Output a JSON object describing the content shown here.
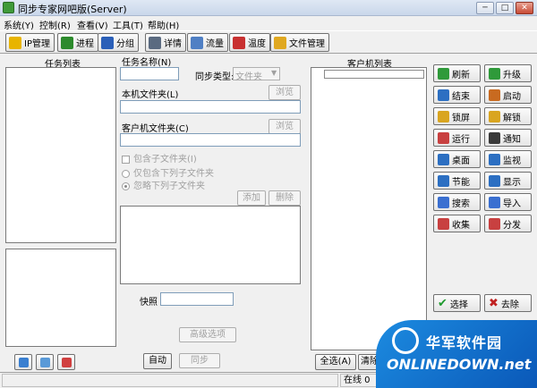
{
  "window": {
    "title": "同步专家网吧版(Server)",
    "minimize": "─",
    "maximize": "□",
    "close": "✕"
  },
  "menu": [
    "系统(Y)",
    "控制(R)",
    "查看(V)",
    "工具(T)",
    "帮助(H)"
  ],
  "toolbar": [
    {
      "label": "IP管理",
      "icon": "network-icon",
      "color": "#e8b400"
    },
    {
      "label": "进程",
      "icon": "process-icon",
      "color": "#2c8a2c"
    },
    {
      "label": "分组",
      "icon": "group-icon",
      "color": "#2a5fb8"
    },
    {
      "label": "详情",
      "icon": "details-icon",
      "color": "#5a6a80"
    },
    {
      "label": "流量",
      "icon": "traffic-icon",
      "color": "#4f7fc4"
    },
    {
      "label": "温度",
      "icon": "thermometer-icon",
      "color": "#c83030"
    },
    {
      "label": "文件管理",
      "icon": "file-manager-icon",
      "color": "#e0a820"
    }
  ],
  "task_panel": {
    "title": "任务列表"
  },
  "task_form": {
    "task_name_label": "任务名称(N)",
    "sync_type_label": "同步类型:",
    "sync_type_value": "文件夹",
    "local_folder_label": "本机文件夹(L)",
    "browse_label": "浏览",
    "client_folder_label": "客户机文件夹(C)",
    "include_subfolders_label": "包含子文件夹(I)",
    "only_include_label": "仅包含下列子文件夹",
    "ignore_label": "忽略下列子文件夹",
    "add_label": "添加",
    "delete_label": "删除",
    "snapshot_label": "快照",
    "advanced_label": "高级选项",
    "auto_label": "自动",
    "sync_label": "同步"
  },
  "client_panel": {
    "title": "客户机列表",
    "select_all": "全选(A)",
    "clear": "清除"
  },
  "actions": [
    {
      "label": "刷新",
      "icon": "refresh-icon",
      "color": "#2f9a3a"
    },
    {
      "label": "升级",
      "icon": "upgrade-icon",
      "color": "#2f9a3a"
    },
    {
      "label": "结束",
      "icon": "end-icon",
      "color": "#2c6fc2"
    },
    {
      "label": "启动",
      "icon": "start-icon",
      "color": "#c86a20"
    },
    {
      "label": "锁屏",
      "icon": "lock-screen-icon",
      "color": "#d9a520"
    },
    {
      "label": "解锁",
      "icon": "unlock-icon",
      "color": "#d9a520"
    },
    {
      "label": "运行",
      "icon": "run-icon",
      "color": "#c84040"
    },
    {
      "label": "通知",
      "icon": "notify-icon",
      "color": "#3a3a3a"
    },
    {
      "label": "桌面",
      "icon": "desktop-icon",
      "color": "#2c6fc2"
    },
    {
      "label": "监视",
      "icon": "monitor-icon",
      "color": "#2c6fc2"
    },
    {
      "label": "节能",
      "icon": "power-save-icon",
      "color": "#2c6fc2"
    },
    {
      "label": "显示",
      "icon": "display-icon",
      "color": "#2c6fc2"
    },
    {
      "label": "搜索",
      "icon": "search-icon",
      "color": "#3a6fd0"
    },
    {
      "label": "导入",
      "icon": "import-icon",
      "color": "#3a6fd0"
    },
    {
      "label": "收集",
      "icon": "collect-icon",
      "color": "#c84040"
    },
    {
      "label": "分发",
      "icon": "distribute-icon",
      "color": "#c84040"
    }
  ],
  "bottom_actions": {
    "select": "选择",
    "remove": "去除"
  },
  "status": {
    "online": "在线 0"
  },
  "watermark": {
    "cn": "华军软件园",
    "en": "ONLINEDOWN.net"
  }
}
